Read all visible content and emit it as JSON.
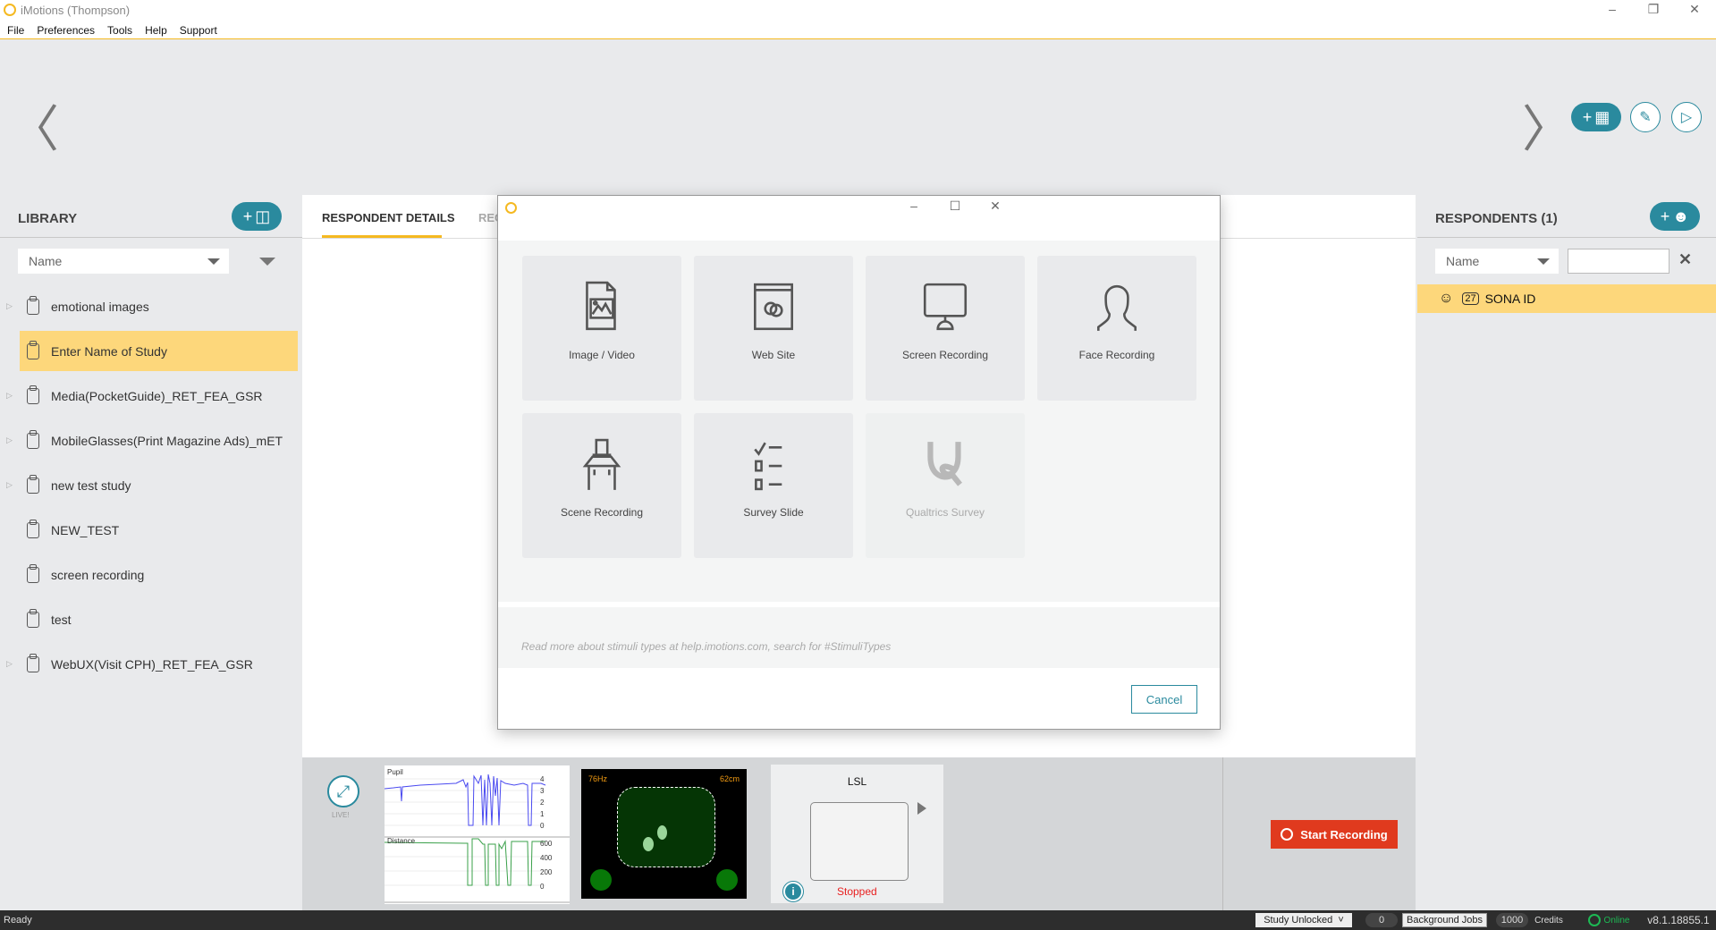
{
  "window": {
    "title": "iMotions (Thompson)"
  },
  "menu": [
    "File",
    "Preferences",
    "Tools",
    "Help",
    "Support"
  ],
  "library": {
    "title": "LIBRARY",
    "sort": "Name",
    "items": [
      {
        "label": "emotional images",
        "expandable": true,
        "selected": false
      },
      {
        "label": "Enter Name of Study",
        "expandable": false,
        "selected": true
      },
      {
        "label": "Media(PocketGuide)_RET_FEA_GSR",
        "expandable": true,
        "selected": false
      },
      {
        "label": "MobileGlasses(Print Magazine Ads)_mET",
        "expandable": true,
        "selected": false
      },
      {
        "label": "new test study",
        "expandable": true,
        "selected": false
      },
      {
        "label": "NEW_TEST",
        "expandable": false,
        "selected": false
      },
      {
        "label": "screen recording",
        "expandable": false,
        "selected": false
      },
      {
        "label": "test",
        "expandable": false,
        "selected": false
      },
      {
        "label": "WebUX(Visit CPH)_RET_FEA_GSR",
        "expandable": true,
        "selected": false
      }
    ]
  },
  "center": {
    "tabs": [
      "RESPONDENT DETAILS",
      "REC"
    ]
  },
  "respondents": {
    "title": "RESPONDENTS (1)",
    "sort": "Name",
    "search": "",
    "items": [
      {
        "badge": "27",
        "label": "SONA ID"
      }
    ]
  },
  "dialog": {
    "tiles": [
      {
        "label": "Image / Video",
        "icon": "image-video-icon",
        "enabled": true
      },
      {
        "label": "Web Site",
        "icon": "web-site-icon",
        "enabled": true
      },
      {
        "label": "Screen Recording",
        "icon": "monitor-icon",
        "enabled": true
      },
      {
        "label": "Face Recording",
        "icon": "person-icon",
        "enabled": true
      },
      {
        "label": "Scene Recording",
        "icon": "desk-icon",
        "enabled": true
      },
      {
        "label": "Survey Slide",
        "icon": "checklist-icon",
        "enabled": true
      },
      {
        "label": "Qualtrics Survey",
        "icon": "qualtrics-icon",
        "enabled": false
      }
    ],
    "help": "Read more about stimuli types at help.imotions.com, search for #StimuliTypes",
    "cancel": "Cancel"
  },
  "bottom": {
    "live": "LIVE!",
    "pupil_label": "Pupil",
    "pupil_ticks": [
      "4",
      "3",
      "2",
      "1",
      "0"
    ],
    "distance_label": "Distance",
    "distance_ticks": [
      "600",
      "400",
      "200",
      "0"
    ],
    "gaze_rate": "76Hz",
    "gaze_distance": "62cm",
    "lsl_title": "LSL",
    "lsl_status": "Stopped",
    "start_recording": "Start Recording"
  },
  "status": {
    "ready": "Ready",
    "lock": "Study Unlocked",
    "jobs_count": "0",
    "jobs": "Background Jobs",
    "credits_value": "1000",
    "credits": "Credits",
    "online": "Online",
    "version": "v8.1.18855.1"
  },
  "colors": {
    "accent": "#2a8a9e",
    "selection": "#fdd77b",
    "record": "#e03a1e",
    "brand": "#f5b921"
  }
}
